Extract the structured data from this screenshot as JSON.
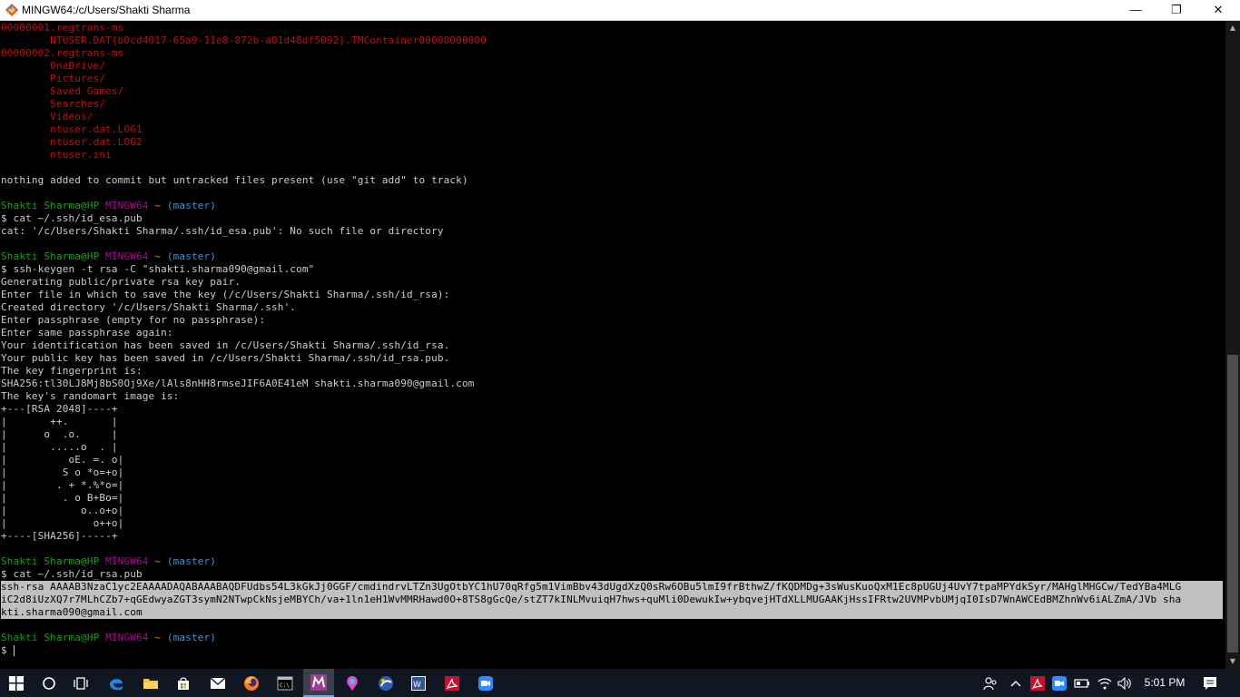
{
  "window": {
    "title": "MINGW64:/c/Users/Shakti Sharma",
    "controls": {
      "minimize": "—",
      "maximize": "❐",
      "close": "✕"
    }
  },
  "terminal": {
    "lines": [
      [
        {
          "t": "00000001.regtrans-ms",
          "c": "red"
        }
      ],
      [
        {
          "t": "        NTUSER.DAT{b0cd4017-65a9-11e8-872b-a01d48df5092}.TMContainer00000000000",
          "c": "red"
        }
      ],
      [
        {
          "t": "00000002.regtrans-ms",
          "c": "red"
        }
      ],
      [
        {
          "t": "        OneDrive/",
          "c": "red"
        }
      ],
      [
        {
          "t": "        Pictures/",
          "c": "red"
        }
      ],
      [
        {
          "t": "        Saved Games/",
          "c": "red"
        }
      ],
      [
        {
          "t": "        Searches/",
          "c": "red"
        }
      ],
      [
        {
          "t": "        Videos/",
          "c": "red"
        }
      ],
      [
        {
          "t": "        ntuser.dat.LOG1",
          "c": "red"
        }
      ],
      [
        {
          "t": "        ntuser.dat.LOG2",
          "c": "red"
        }
      ],
      [
        {
          "t": "        ntuser.ini",
          "c": "red"
        }
      ],
      [],
      [
        {
          "t": "nothing added to commit but untracked files present (use \"git add\" to track)",
          "c": "white"
        }
      ],
      [],
      [
        {
          "t": "Shakti Sharma@HP ",
          "c": "green"
        },
        {
          "t": "MINGW64 ",
          "c": "magenta"
        },
        {
          "t": "~ ",
          "c": "yellow"
        },
        {
          "t": "(master)",
          "c": "cyan"
        }
      ],
      [
        {
          "t": "$ cat ~/.ssh/id_esa.pub",
          "c": "white"
        }
      ],
      [
        {
          "t": "cat: '/c/Users/Shakti Sharma/.ssh/id_esa.pub': No such file or directory",
          "c": "white"
        }
      ],
      [],
      [
        {
          "t": "Shakti Sharma@HP ",
          "c": "green"
        },
        {
          "t": "MINGW64 ",
          "c": "magenta"
        },
        {
          "t": "~ ",
          "c": "yellow"
        },
        {
          "t": "(master)",
          "c": "cyan"
        }
      ],
      [
        {
          "t": "$ ssh-keygen -t rsa -C \"shakti.sharma090@gmail.com\"",
          "c": "white"
        }
      ],
      [
        {
          "t": "Generating public/private rsa key pair.",
          "c": "white"
        }
      ],
      [
        {
          "t": "Enter file in which to save the key (/c/Users/Shakti Sharma/.ssh/id_rsa):",
          "c": "white"
        }
      ],
      [
        {
          "t": "Created directory '/c/Users/Shakti Sharma/.ssh'.",
          "c": "white"
        }
      ],
      [
        {
          "t": "Enter passphrase (empty for no passphrase):",
          "c": "white"
        }
      ],
      [
        {
          "t": "Enter same passphrase again:",
          "c": "white"
        }
      ],
      [
        {
          "t": "Your identification has been saved in /c/Users/Shakti Sharma/.ssh/id_rsa.",
          "c": "white"
        }
      ],
      [
        {
          "t": "Your public key has been saved in /c/Users/Shakti Sharma/.ssh/id_rsa.pub.",
          "c": "white"
        }
      ],
      [
        {
          "t": "The key fingerprint is:",
          "c": "white"
        }
      ],
      [
        {
          "t": "SHA256:tl30LJ8Mj8bS0Oj9Xe/lAls8nHH8rmseJIF6A0E41eM shakti.sharma090@gmail.com",
          "c": "white"
        }
      ],
      [
        {
          "t": "The key's randomart image is:",
          "c": "white"
        }
      ],
      [
        {
          "t": "+---[RSA 2048]----+",
          "c": "white"
        }
      ],
      [
        {
          "t": "|       ++.       |",
          "c": "white"
        }
      ],
      [
        {
          "t": "|      o  .o.     |",
          "c": "white"
        }
      ],
      [
        {
          "t": "|       .....o  . |",
          "c": "white"
        }
      ],
      [
        {
          "t": "|          oE. =. o|",
          "c": "white"
        }
      ],
      [
        {
          "t": "|         S o *o=+o|",
          "c": "white"
        }
      ],
      [
        {
          "t": "|        . + *.%*o=|",
          "c": "white"
        }
      ],
      [
        {
          "t": "|         . o B+Bo=|",
          "c": "white"
        }
      ],
      [
        {
          "t": "|            o..o+o|",
          "c": "white"
        }
      ],
      [
        {
          "t": "|              o++o|",
          "c": "white"
        }
      ],
      [
        {
          "t": "+----[SHA256]-----+",
          "c": "white"
        }
      ],
      [],
      [
        {
          "t": "Shakti Sharma@HP ",
          "c": "green"
        },
        {
          "t": "MINGW64 ",
          "c": "magenta"
        },
        {
          "t": "~ ",
          "c": "yellow"
        },
        {
          "t": "(master)",
          "c": "cyan"
        }
      ],
      [
        {
          "t": "$ cat ~/.ssh/id_rsa.pub",
          "c": "white"
        }
      ],
      [
        {
          "t": "ssh-rsa AAAAB3NzaC1yc2EAAAADAQABAAABAQDFUdbs54L3kGkJj0GGF/cmdindrvLTZn3UgOtbYC1hU70qRfg5m1VimBbv43dUgdXzQ0sRw6OBu5lmI9frBthwZ/fKQDMDg+3sWusKuoQxM1Ec8pUGUj4UvY7tpaMPYdkSyr/MAHglMHGCw/TedYBa4MLG",
          "c": "sel"
        }
      ],
      [
        {
          "t": "iC2d8iUzXQ7r7MLhCZb7+qGEdwyaZGT3symN2NTwpCkNsjeMBYCh/va+1ln1eH1WvMMRHawd0O+8TS8gGcQe/stZT7kINLMvuiqH7hws+quMli0DewukIw+ybqvejHTdXLLMUGAAKjHssIFRtw2UVMPvbUMjqI0IsD7WnAWCEdBMZhnWv6iALZmA/JVb sha",
          "c": "sel"
        }
      ],
      [
        {
          "t": "kti.sharma090@gmail.com",
          "c": "sel"
        }
      ],
      [],
      [
        {
          "t": "Shakti Sharma@HP ",
          "c": "green"
        },
        {
          "t": "MINGW64 ",
          "c": "magenta"
        },
        {
          "t": "~ ",
          "c": "yellow"
        },
        {
          "t": "(master)",
          "c": "cyan"
        }
      ],
      [
        {
          "t": "$ ",
          "c": "white"
        }
      ]
    ]
  },
  "scrollbar": {
    "up": "▲",
    "down": "▼",
    "position": 0.52
  },
  "taskbar": {
    "items": [
      "windows-start",
      "cortana-search",
      "task-view",
      "edge",
      "file-explorer",
      "store",
      "mail",
      "firefox",
      "cmd",
      "git-bash",
      "paint-3d",
      "app",
      "word-app",
      "acrobat",
      "zoom"
    ],
    "tray": [
      "people",
      "show-hidden",
      "acrobat-tray",
      "zoom-tray",
      "battery",
      "wifi",
      "volume"
    ],
    "clock": "5:01 PM"
  }
}
